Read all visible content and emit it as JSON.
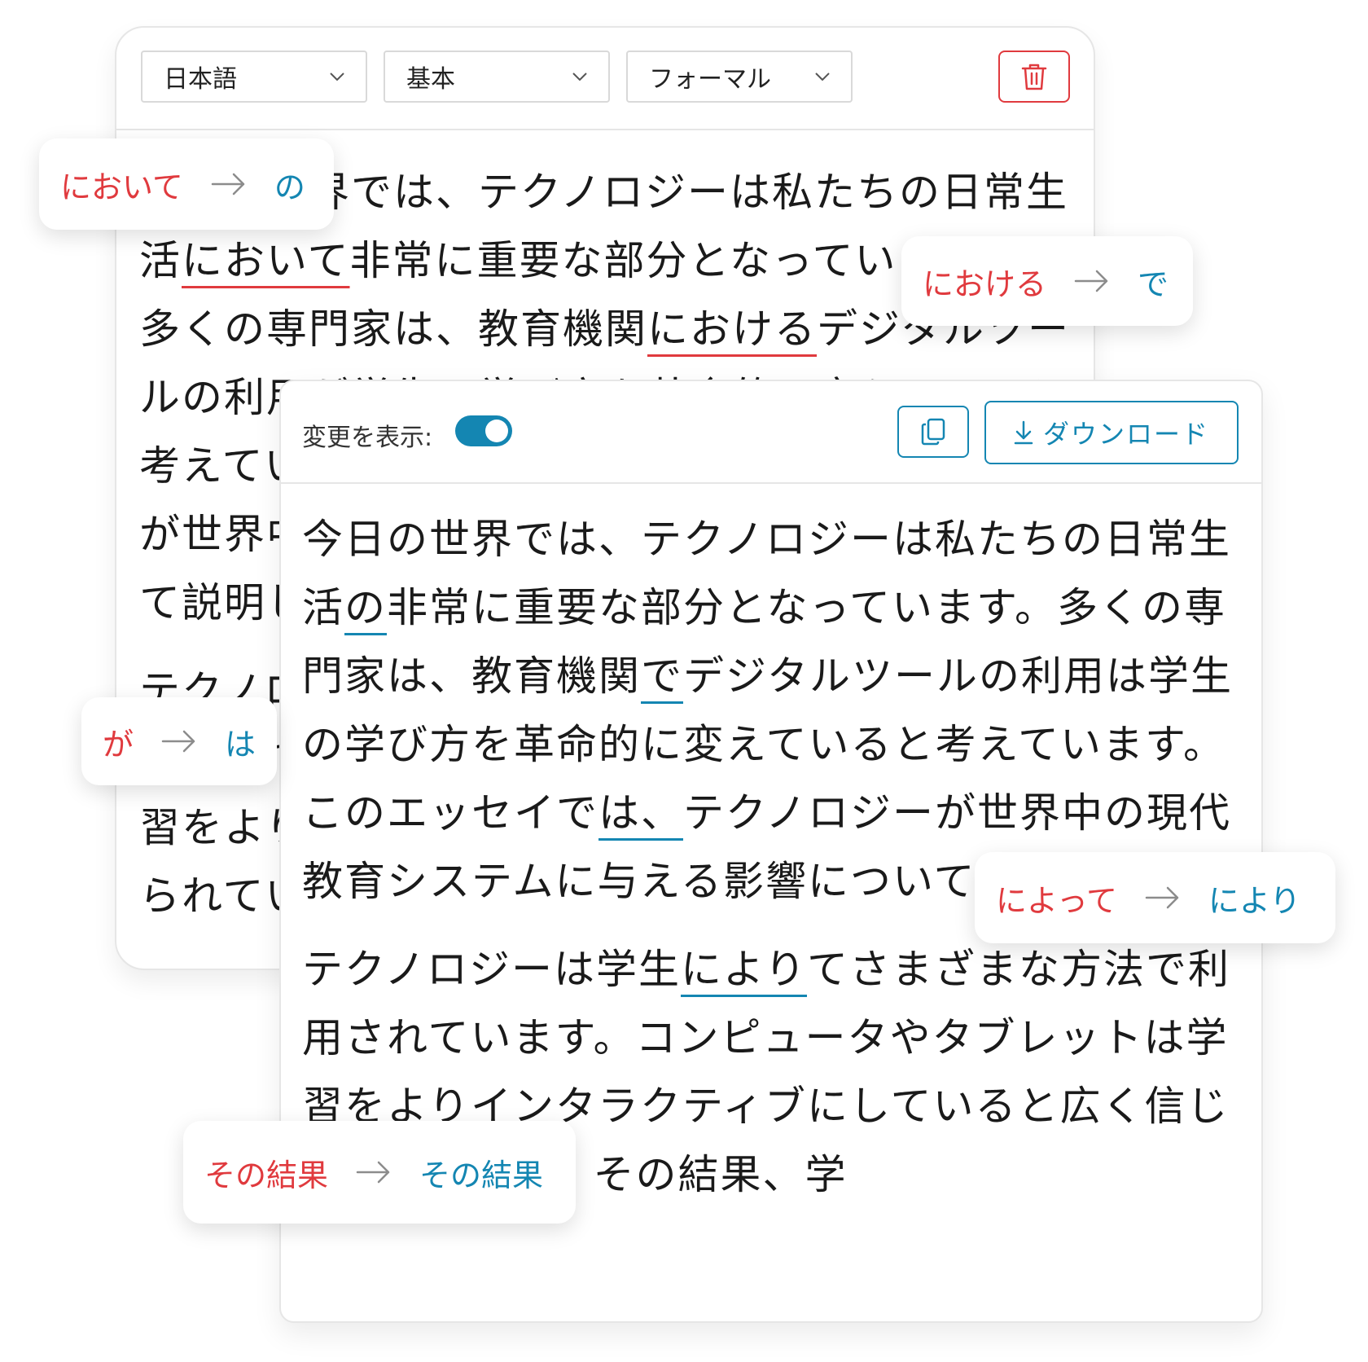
{
  "source_editor": {
    "language_select": "日本語",
    "mode_select": "基本",
    "tone_select": "フォーマル",
    "paragraphs": [
      [
        {
          "t": "今日の世界では、テクノロジーは私たちの日"
        },
        {
          "t": "常生活"
        },
        {
          "t": "において",
          "mark": "red"
        },
        {
          "t": "非常に重要な部分となっていま"
        },
        {
          "t": "ます。多くの専門家は、教育機関"
        },
        {
          "t": "における",
          "mark": "red"
        },
        {
          "t": "デジタルツールの利用が学生の学び方を革命的に変えていると考えています。このエッセイでは、テクノロジーが世界中の現代教育システムに与える影響について説明します。"
        }
      ],
      [
        {
          "t": "テクノロジーは学生によってさまざまな方法で利用されています。コンピュータやタブレットは学習をよりインタラクティブにしていると広く信じられています。"
        }
      ]
    ]
  },
  "output_editor": {
    "show_changes_label": "変更を表示:",
    "download_label": "ダウンロード",
    "paragraphs": [
      [
        {
          "t": "今日の世界では、テクノロジーは私たちの日常生活"
        },
        {
          "t": "の",
          "mark": "blue"
        },
        {
          "t": "非常に重要な部分となっています。多くの専門家は、教育機関"
        },
        {
          "t": "で",
          "mark": "blue"
        },
        {
          "t": "デジタルツールの利用は学生の学び方を革命的に変えていると考えています。このエッセイで"
        },
        {
          "t": "は、",
          "mark": "blue"
        },
        {
          "t": "テクノロジーが世界中の現代教育システムに与える影響について説明します。"
        }
      ],
      [
        {
          "t": "テクノロジーは学生"
        },
        {
          "t": "により",
          "mark": "blue"
        },
        {
          "t": "てさまざまな方法で利用されています。コンピュータやタブレットは学習をよりインタラクティブにしていると広く信じられています。その結果、学"
        }
      ]
    ]
  },
  "suggestions": [
    {
      "old": "において",
      "new": "の"
    },
    {
      "old": "における",
      "new": "で"
    },
    {
      "old": "が",
      "new": "は"
    },
    {
      "old": "によって",
      "new": "により"
    },
    {
      "old": "その結果",
      "new": "その結果"
    }
  ],
  "colors": {
    "removed": "#e03a3e",
    "added": "#1486b2",
    "arrow": "#8c8c8c"
  }
}
